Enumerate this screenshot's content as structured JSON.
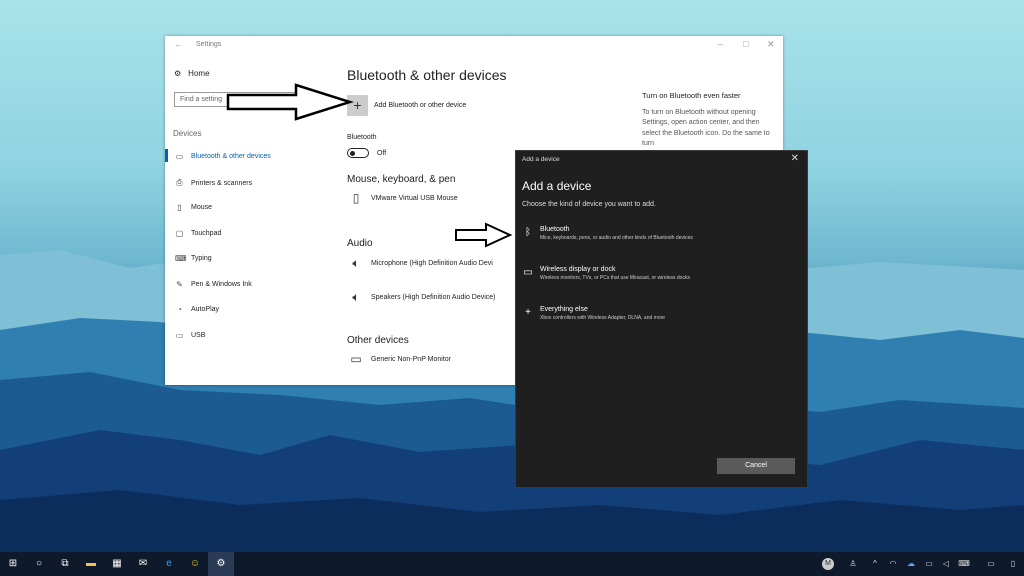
{
  "settings": {
    "window_title": "Settings",
    "back_icon": "back-arrow-icon",
    "home_label": "Home",
    "search_placeholder": "Find a setting",
    "nav_header": "Devices",
    "nav_items": [
      {
        "label": "Bluetooth & other devices",
        "icon": "bluetooth-devices-icon",
        "active": true
      },
      {
        "label": "Printers & scanners",
        "icon": "printer-icon"
      },
      {
        "label": "Mouse",
        "icon": "mouse-icon"
      },
      {
        "label": "Touchpad",
        "icon": "touchpad-icon"
      },
      {
        "label": "Typing",
        "icon": "keyboard-icon"
      },
      {
        "label": "Pen & Windows Ink",
        "icon": "pen-icon"
      },
      {
        "label": "AutoPlay",
        "icon": "autoplay-icon"
      },
      {
        "label": "USB",
        "icon": "usb-icon"
      }
    ],
    "page_title": "Bluetooth & other devices",
    "add_device_label": "Add Bluetooth or other device",
    "bluetooth_label": "Bluetooth",
    "bluetooth_state": "Off",
    "section_mouse": "Mouse, keyboard, & pen",
    "mouse_device": "VMware Virtual USB Mouse",
    "section_audio": "Audio",
    "audio_devices": [
      "Microphone (High Definition Audio Devi",
      "Speakers (High Definition Audio Device)"
    ],
    "section_other": "Other devices",
    "other_device": "Generic Non-PnP Monitor",
    "side_title": "Turn on Bluetooth even faster",
    "side_text": "To turn on Bluetooth without opening Settings, open action center, and then select the Bluetooth icon. Do the same to turn"
  },
  "dialog": {
    "title": "Add a device",
    "heading": "Add a device",
    "subtitle": "Choose the kind of device you want to add.",
    "options": [
      {
        "title": "Bluetooth",
        "desc": "Mice, keyboards, pens, or audio and other kinds of Bluetooth devices",
        "icon": "bluetooth-icon"
      },
      {
        "title": "Wireless display or dock",
        "desc": "Wireless monitors, TVs, or PCs that use Miracast, or wireless docks",
        "icon": "monitor-icon"
      },
      {
        "title": "Everything else",
        "desc": "Xbox controllers with Wireless Adapter, DLNA, and more",
        "icon": "plus-icon"
      }
    ],
    "cancel_label": "Cancel"
  },
  "taskbar": {
    "avatar_letter": "M",
    "items": [
      "start-icon",
      "cortana-icon",
      "task-view-icon",
      "file-explorer-icon",
      "store-icon",
      "mail-icon",
      "edge-icon",
      "emoji-app-icon",
      "settings-icon"
    ]
  },
  "colors": {
    "accent": "#0063b1",
    "dialog_bg": "#1f1f1f",
    "taskbar_bg": "#0e1a2b"
  }
}
